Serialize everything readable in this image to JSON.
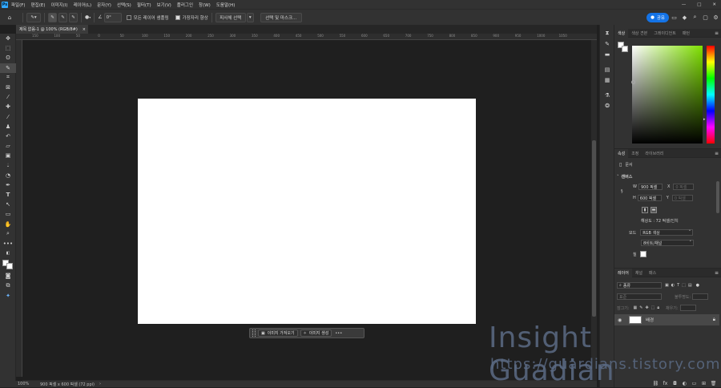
{
  "app": {
    "logo": "Ps"
  },
  "menu": [
    "파일(F)",
    "편집(E)",
    "이미지(I)",
    "레이어(L)",
    "문자(Y)",
    "선택(S)",
    "필터(T)",
    "보기(V)",
    "플러그인",
    "창(W)",
    "도움말(H)"
  ],
  "window_controls": {
    "minimize": "—",
    "maximize": "□",
    "close": "✕"
  },
  "account": {
    "label": "공유"
  },
  "options": {
    "angle": "0°",
    "sample_all_layers": "모든 레이어 샘플링",
    "enhance_edge": "가장자리 향상",
    "subject_select": "피사체 선택",
    "select_and_mask": "선택 및 마스크..."
  },
  "document_tab": {
    "title": "제목 없음-1 @ 100% (RGB/8#)",
    "close": "×"
  },
  "ruler_h_labels": [
    "150",
    "100",
    "50",
    "0",
    "50",
    "100",
    "150",
    "200",
    "250",
    "300",
    "350",
    "400",
    "450",
    "500",
    "550",
    "600",
    "650",
    "700",
    "750",
    "800",
    "850",
    "900",
    "950",
    "1000",
    "1050"
  ],
  "status": {
    "zoom": "100%",
    "doc_info": "900 픽셀 x 600 픽셀 (72 ppi)"
  },
  "context_bar": {
    "import": "이미지 가져오기",
    "generate": "이미지 생성",
    "more": "•••"
  },
  "color_panel": {
    "tabs": [
      "색상",
      "색상 견본",
      "그레이디언트",
      "패턴"
    ],
    "active": 0,
    "hue_color": "#7fe000"
  },
  "properties_panel": {
    "tabs": [
      "속성",
      "조정",
      "라이브러리"
    ],
    "active": 0,
    "doc_label": "문서",
    "canvas_label": "캔버스",
    "w_label": "W",
    "w_value": "900 픽셀",
    "h_label": "H",
    "h_value": "600 픽셀",
    "x_label": "X",
    "x_value": "0 픽셀",
    "y_label": "Y",
    "y_value": "0 픽셀",
    "resolution": "해상도 : 72 픽셀/인치",
    "mode_label": "모드",
    "mode_value": "RGB 색상",
    "bit_value": "8비트/채널",
    "fill_label": "칠"
  },
  "layers_panel": {
    "tabs": [
      "레이어",
      "채널",
      "패스"
    ],
    "active": 0,
    "search_placeholder": "종류",
    "blend_mode": "표준",
    "opacity_label": "불투명도:",
    "lock_label": "잠그기:",
    "fill_label": "채우기:",
    "layer_name": "배경"
  },
  "watermark": {
    "title": "Insight Guadian",
    "url": "https://guardians.tistory.com"
  },
  "colors": {
    "canvas": "#ffffff",
    "accent": "#1473e6",
    "workspace": "#1f1f1f"
  }
}
